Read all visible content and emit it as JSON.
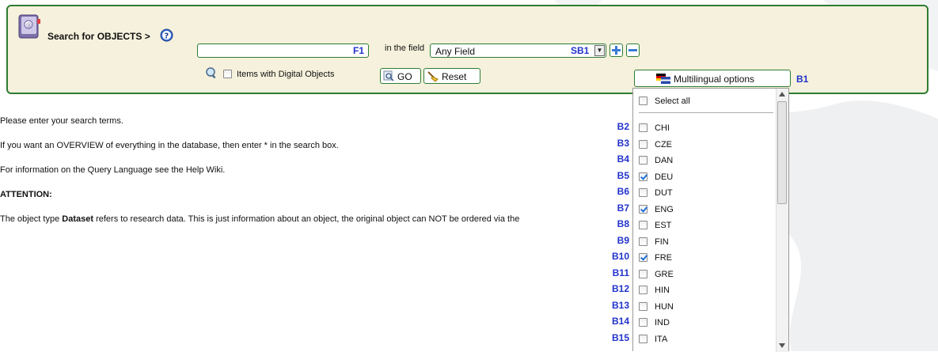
{
  "search": {
    "title": "Search for OBJECTS >",
    "input_value": "",
    "input_annotation": "F1",
    "in_field_label": "in the field",
    "field_select_value": "Any Field",
    "field_select_annotation": "SB1",
    "digital_objects_label": "Items with Digital Objects",
    "go_label": "GO",
    "reset_label": "Reset",
    "multilingual_label": "Multilingual options",
    "multilingual_annotation": "B1"
  },
  "languages": {
    "select_all_label": "Select all",
    "items": [
      {
        "code": "CHI",
        "checked": false,
        "annotation": "B2"
      },
      {
        "code": "CZE",
        "checked": false,
        "annotation": "B3"
      },
      {
        "code": "DAN",
        "checked": false,
        "annotation": "B4"
      },
      {
        "code": "DEU",
        "checked": true,
        "annotation": "B5"
      },
      {
        "code": "DUT",
        "checked": false,
        "annotation": "B6"
      },
      {
        "code": "ENG",
        "checked": true,
        "annotation": "B7"
      },
      {
        "code": "EST",
        "checked": false,
        "annotation": "B8"
      },
      {
        "code": "FIN",
        "checked": false,
        "annotation": "B9"
      },
      {
        "code": "FRE",
        "checked": true,
        "annotation": "B10"
      },
      {
        "code": "GRE",
        "checked": false,
        "annotation": "B11"
      },
      {
        "code": "HIN",
        "checked": false,
        "annotation": "B12"
      },
      {
        "code": "HUN",
        "checked": false,
        "annotation": "B13"
      },
      {
        "code": "IND",
        "checked": false,
        "annotation": "B14"
      },
      {
        "code": "ITA",
        "checked": false,
        "annotation": "B15"
      }
    ]
  },
  "info": {
    "line1": "Please enter your search terms.",
    "line2": "If you want an OVERVIEW of everything in the database, then enter * in the search box.",
    "line3": "For information on the Query Language see the Help Wiki.",
    "attention": "ATTENTION:",
    "line4_prefix": "The object type ",
    "line4_bold": "Dataset",
    "line4_suffix": " refers to research data. This is just information about an object, the original object can NOT be ordered via the"
  },
  "colors": {
    "panel_bg": "#f5f1dc",
    "panel_border": "#2e7d32",
    "annotation": "#2233cc",
    "check": "#1f6fd6"
  }
}
